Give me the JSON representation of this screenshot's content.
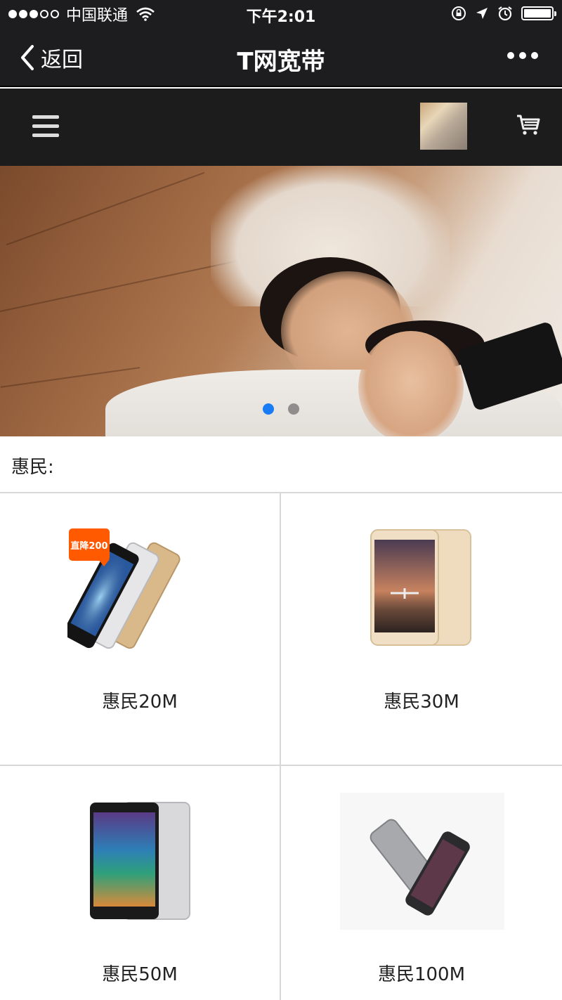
{
  "status_bar": {
    "carrier": "中国联通",
    "time": "下午2:01",
    "battery_level": 1.0
  },
  "nav": {
    "back_label": "返回",
    "title": "T网宽带"
  },
  "banner": {
    "slide_count": 2,
    "active_slide": 1
  },
  "section": {
    "title": "惠民:"
  },
  "products": [
    {
      "name": "惠民20M",
      "badge": "直降200",
      "image": "xiaomi-5-phones"
    },
    {
      "name": "惠民30M",
      "image": "redmi-3-phone"
    },
    {
      "name": "惠民50M",
      "image": "redmi-note-3-phone"
    },
    {
      "name": "惠民100M",
      "image": "iphone-6s-phones"
    }
  ],
  "colors": {
    "status_bar_bg": "#1d1d20",
    "header_bg": "#1c1c1c",
    "dot_active": "#1a7cf5",
    "badge_bg": "#ff5a00"
  }
}
